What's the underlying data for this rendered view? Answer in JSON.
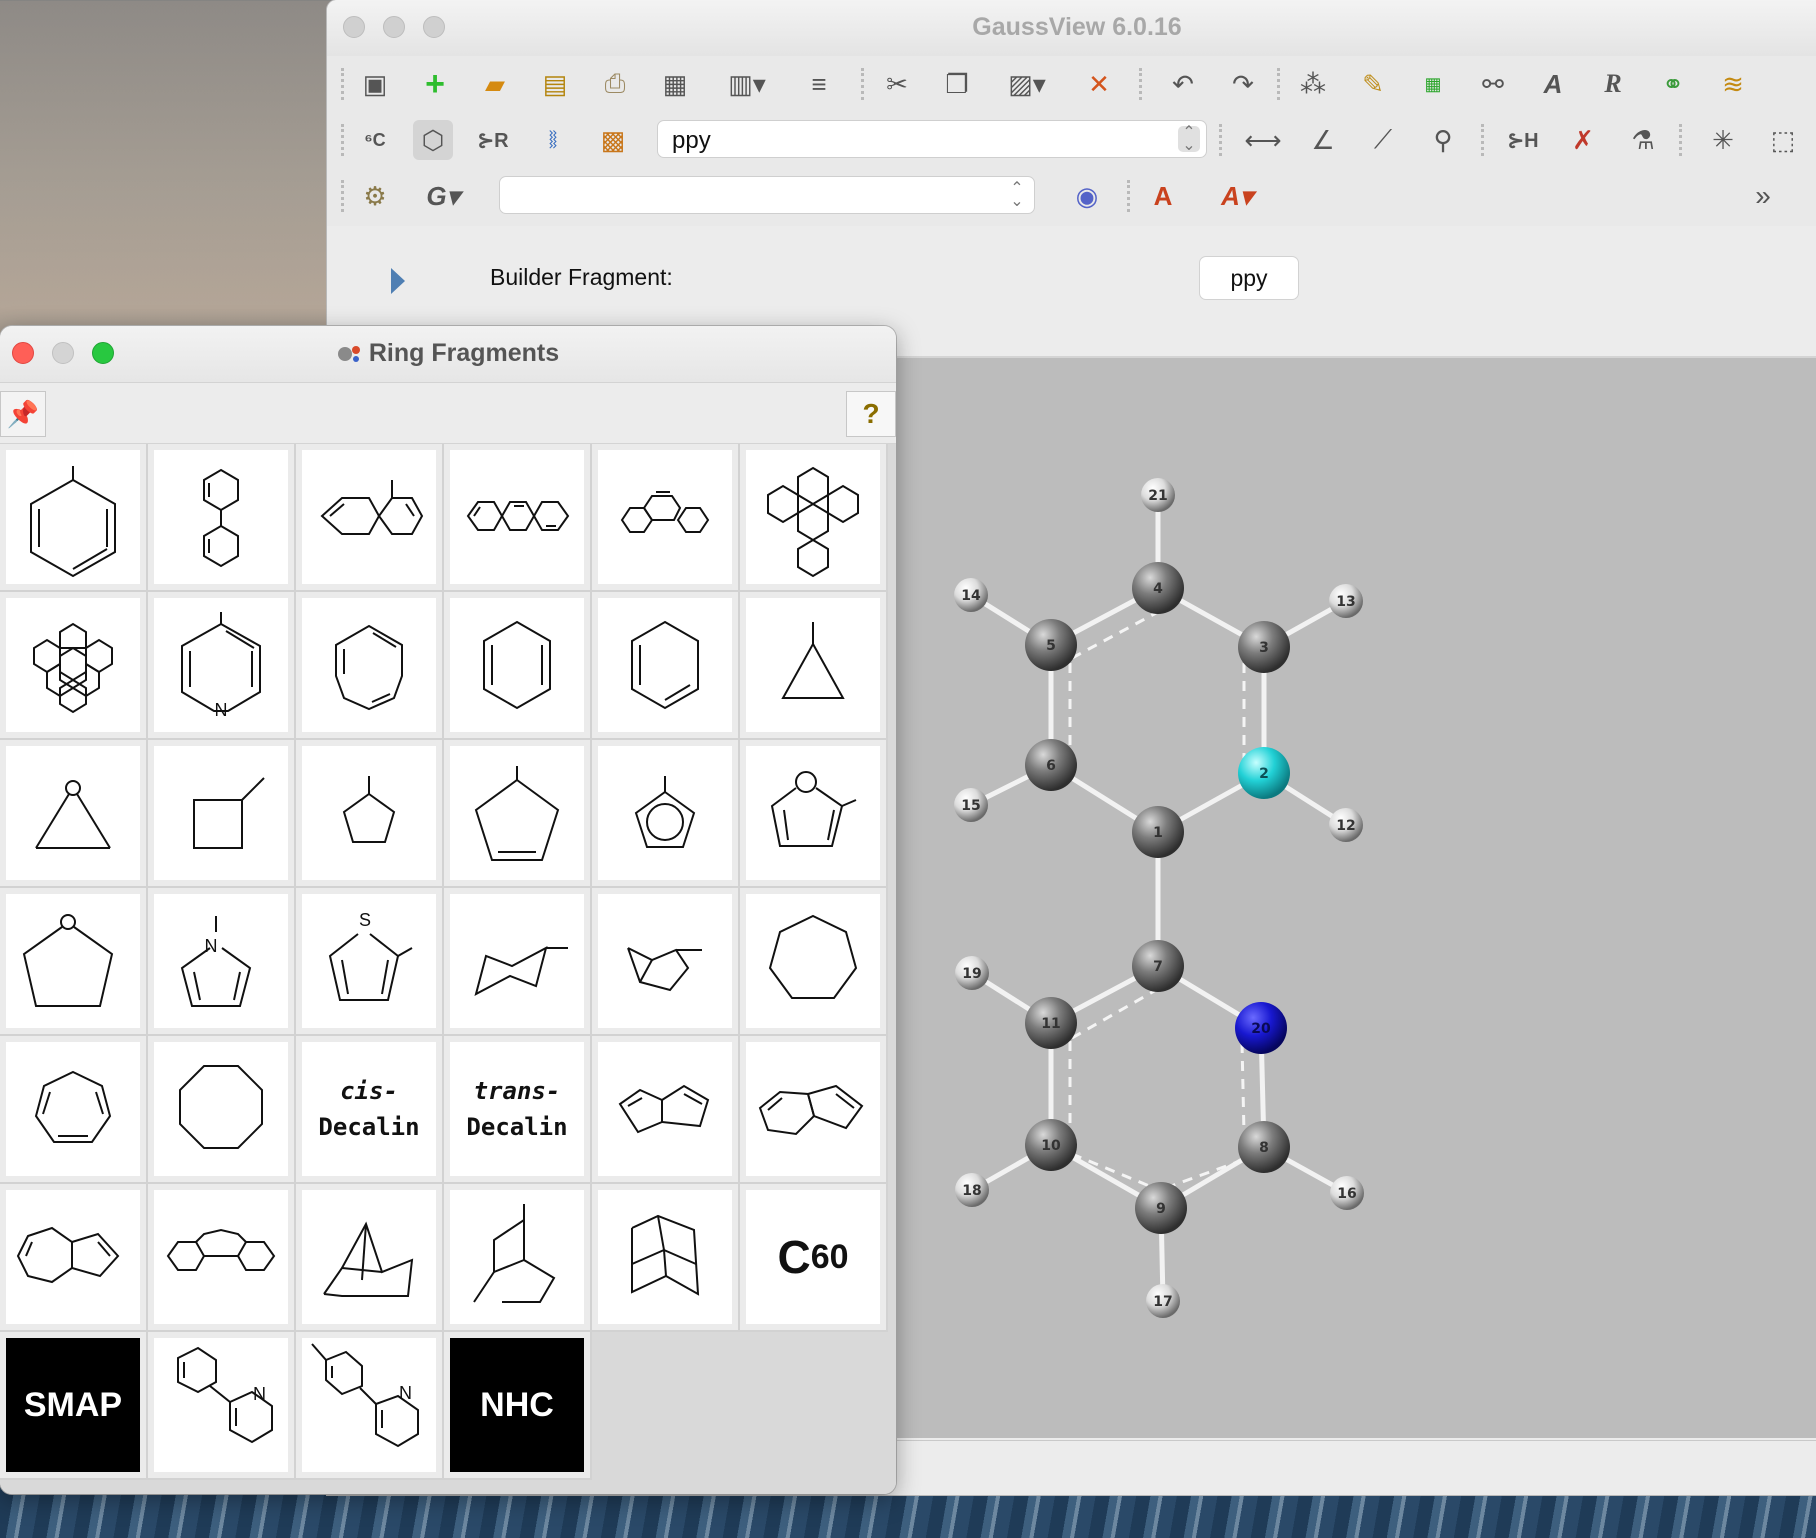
{
  "main_window": {
    "title": "GaussView 6.0.16",
    "toolbar_icons_row1": [
      "new-window-icon",
      "add-icon",
      "open-folder-icon",
      "save-icon",
      "print-icon",
      "image-save-icon",
      "file-menu-icon",
      "list-icon",
      "cut-icon",
      "copy-icon",
      "paste-icon",
      "delete-icon",
      "undo-icon",
      "redo-icon",
      "clean-icon",
      "brush-icon",
      "table-icon",
      "bond-icon",
      "label-icon",
      "r-icon",
      "link-icon",
      "layers-icon"
    ],
    "toolbar_icons_row2": [
      "element-fragment-icon",
      "ring-fragment-icon",
      "r-group-icon",
      "biological-icon",
      "custom-fragment-icon",
      "bond-length-icon",
      "angle-icon",
      "dihedral-icon",
      "inquire-icon",
      "add-h-icon",
      "delete-atom-icon",
      "symmetry-icon",
      "point-icon",
      "select-icon"
    ],
    "toolbar_icons_row3": [
      "calculate-icon",
      "gaussian-calc-icon",
      "molecule-icon",
      "font-icon",
      "font-options-icon"
    ],
    "fragment_combo": "ppy",
    "row3_combo": "",
    "more_label": "»",
    "builder_fragment_label": "Builder Fragment:",
    "builder_fragment_value": "ppy",
    "colors": {
      "carbon": "#8a8a8a",
      "hydrogen": "#e8e8e8",
      "nitrogen_selected": "#2bd4d8",
      "nitrogen": "#1515cc",
      "background": "#bcbcbc"
    }
  },
  "molecule": {
    "atoms": [
      {
        "id": "21",
        "element": "H"
      },
      {
        "id": "4",
        "element": "C"
      },
      {
        "id": "14",
        "element": "H"
      },
      {
        "id": "13",
        "element": "H"
      },
      {
        "id": "5",
        "element": "C"
      },
      {
        "id": "3",
        "element": "C"
      },
      {
        "id": "6",
        "element": "C"
      },
      {
        "id": "2",
        "element": "N"
      },
      {
        "id": "15",
        "element": "H"
      },
      {
        "id": "12",
        "element": "H"
      },
      {
        "id": "1",
        "element": "C"
      },
      {
        "id": "7",
        "element": "C"
      },
      {
        "id": "19",
        "element": "H"
      },
      {
        "id": "11",
        "element": "C"
      },
      {
        "id": "20",
        "element": "N"
      },
      {
        "id": "10",
        "element": "C"
      },
      {
        "id": "8",
        "element": "C"
      },
      {
        "id": "18",
        "element": "H"
      },
      {
        "id": "16",
        "element": "H"
      },
      {
        "id": "9",
        "element": "C"
      },
      {
        "id": "17",
        "element": "H"
      }
    ]
  },
  "palette": {
    "title": "Ring Fragments",
    "pin_icon": "pin-icon",
    "help_label": "?",
    "cells": [
      {
        "name": "benzene"
      },
      {
        "name": "biphenyl"
      },
      {
        "name": "naphthalene"
      },
      {
        "name": "anthracene"
      },
      {
        "name": "phenanthrene"
      },
      {
        "name": "pyrene"
      },
      {
        "name": "coronene"
      },
      {
        "name": "pyridine"
      },
      {
        "name": "pyrimidine"
      },
      {
        "name": "pyrazine"
      },
      {
        "name": "pyridazine"
      },
      {
        "name": "cyclopropane"
      },
      {
        "name": "oxirane"
      },
      {
        "name": "cyclobutane"
      },
      {
        "name": "cyclopentane"
      },
      {
        "name": "cyclopentene"
      },
      {
        "name": "cyclopentadienyl"
      },
      {
        "name": "furan"
      },
      {
        "name": "tetrahydrofuran"
      },
      {
        "name": "pyrrole"
      },
      {
        "name": "thiophene"
      },
      {
        "name": "cyclohexane-chair"
      },
      {
        "name": "cyclohexane-boat"
      },
      {
        "name": "cycloheptane"
      },
      {
        "name": "cycloheptatriene"
      },
      {
        "name": "cyclooctane"
      },
      {
        "name": "cis-decalin",
        "line1": "cis-",
        "line2": "Decalin"
      },
      {
        "name": "trans-decalin",
        "line1": "trans-",
        "line2": "Decalin"
      },
      {
        "name": "pentalene"
      },
      {
        "name": "indene"
      },
      {
        "name": "azulene"
      },
      {
        "name": "fluorene"
      },
      {
        "name": "norbornane"
      },
      {
        "name": "bicyclooctane"
      },
      {
        "name": "adamantane"
      },
      {
        "name": "c60",
        "label": "C",
        "sub": "60"
      },
      {
        "name": "smap",
        "label": "SMAP"
      },
      {
        "name": "ppy"
      },
      {
        "name": "tolylpyridine"
      },
      {
        "name": "nhc",
        "label": "NHC"
      }
    ]
  }
}
